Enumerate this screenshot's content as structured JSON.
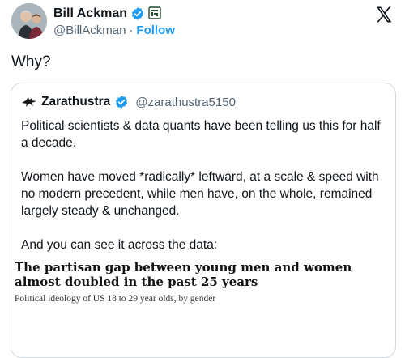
{
  "author": {
    "display_name": "Bill Ackman",
    "handle": "@BillAckman",
    "separator": "·",
    "follow_label": "Follow",
    "verified_icon": "verified-badge-icon",
    "affiliate_icon": "affiliate-badge-icon"
  },
  "platform_icon": "x-logo-icon",
  "tweet": {
    "text": "Why?"
  },
  "quote": {
    "display_name": "Zarathustra",
    "handle": "@zarathustra5150",
    "verified_icon": "verified-badge-icon",
    "paragraphs": [
      "Political scientists & data quants have been telling us this for half a decade.",
      "Women have moved *radically* leftward, at a scale & speed with no modern precedent, while men have, on the whole, remained largely steady & unchanged.",
      "And you can see it across the data:"
    ],
    "article": {
      "headline": "The partisan gap between young men and women almost doubled in the past 25 years",
      "subheading": "Political ideology of US 18 to 29 year olds, by gender"
    }
  },
  "colors": {
    "link": "#1d9bf0",
    "verified": "#1d9bf0",
    "text": "#0f1419",
    "muted": "#536471",
    "border": "#cfd9de"
  }
}
